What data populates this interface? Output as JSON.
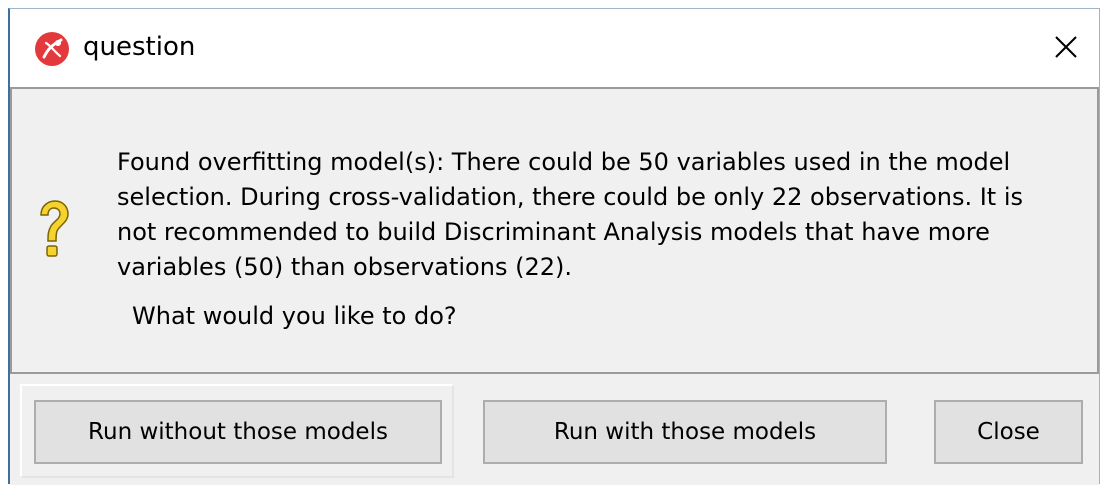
{
  "window": {
    "title": "question"
  },
  "message": {
    "body": "  Found overfitting model(s): There could be 50 variables used in the model\nselection. During cross-validation, there could be only 22 observations. It is\nnot recommended to build Discriminant Analysis models that have more\nvariables (50) than observations (22).",
    "prompt": "What would you like to do?"
  },
  "buttons": {
    "run_without": "Run without those models",
    "run_with": "Run with those models",
    "close": "Close"
  },
  "colors": {
    "icon_red": "#e4393c",
    "question_yellow": "#f5d22e",
    "dialog_gray": "#f0f0f0",
    "button_face": "#e1e1e1"
  },
  "icons": {
    "app": "app-logo-icon",
    "close": "close-icon",
    "question": "question-mark-icon"
  }
}
